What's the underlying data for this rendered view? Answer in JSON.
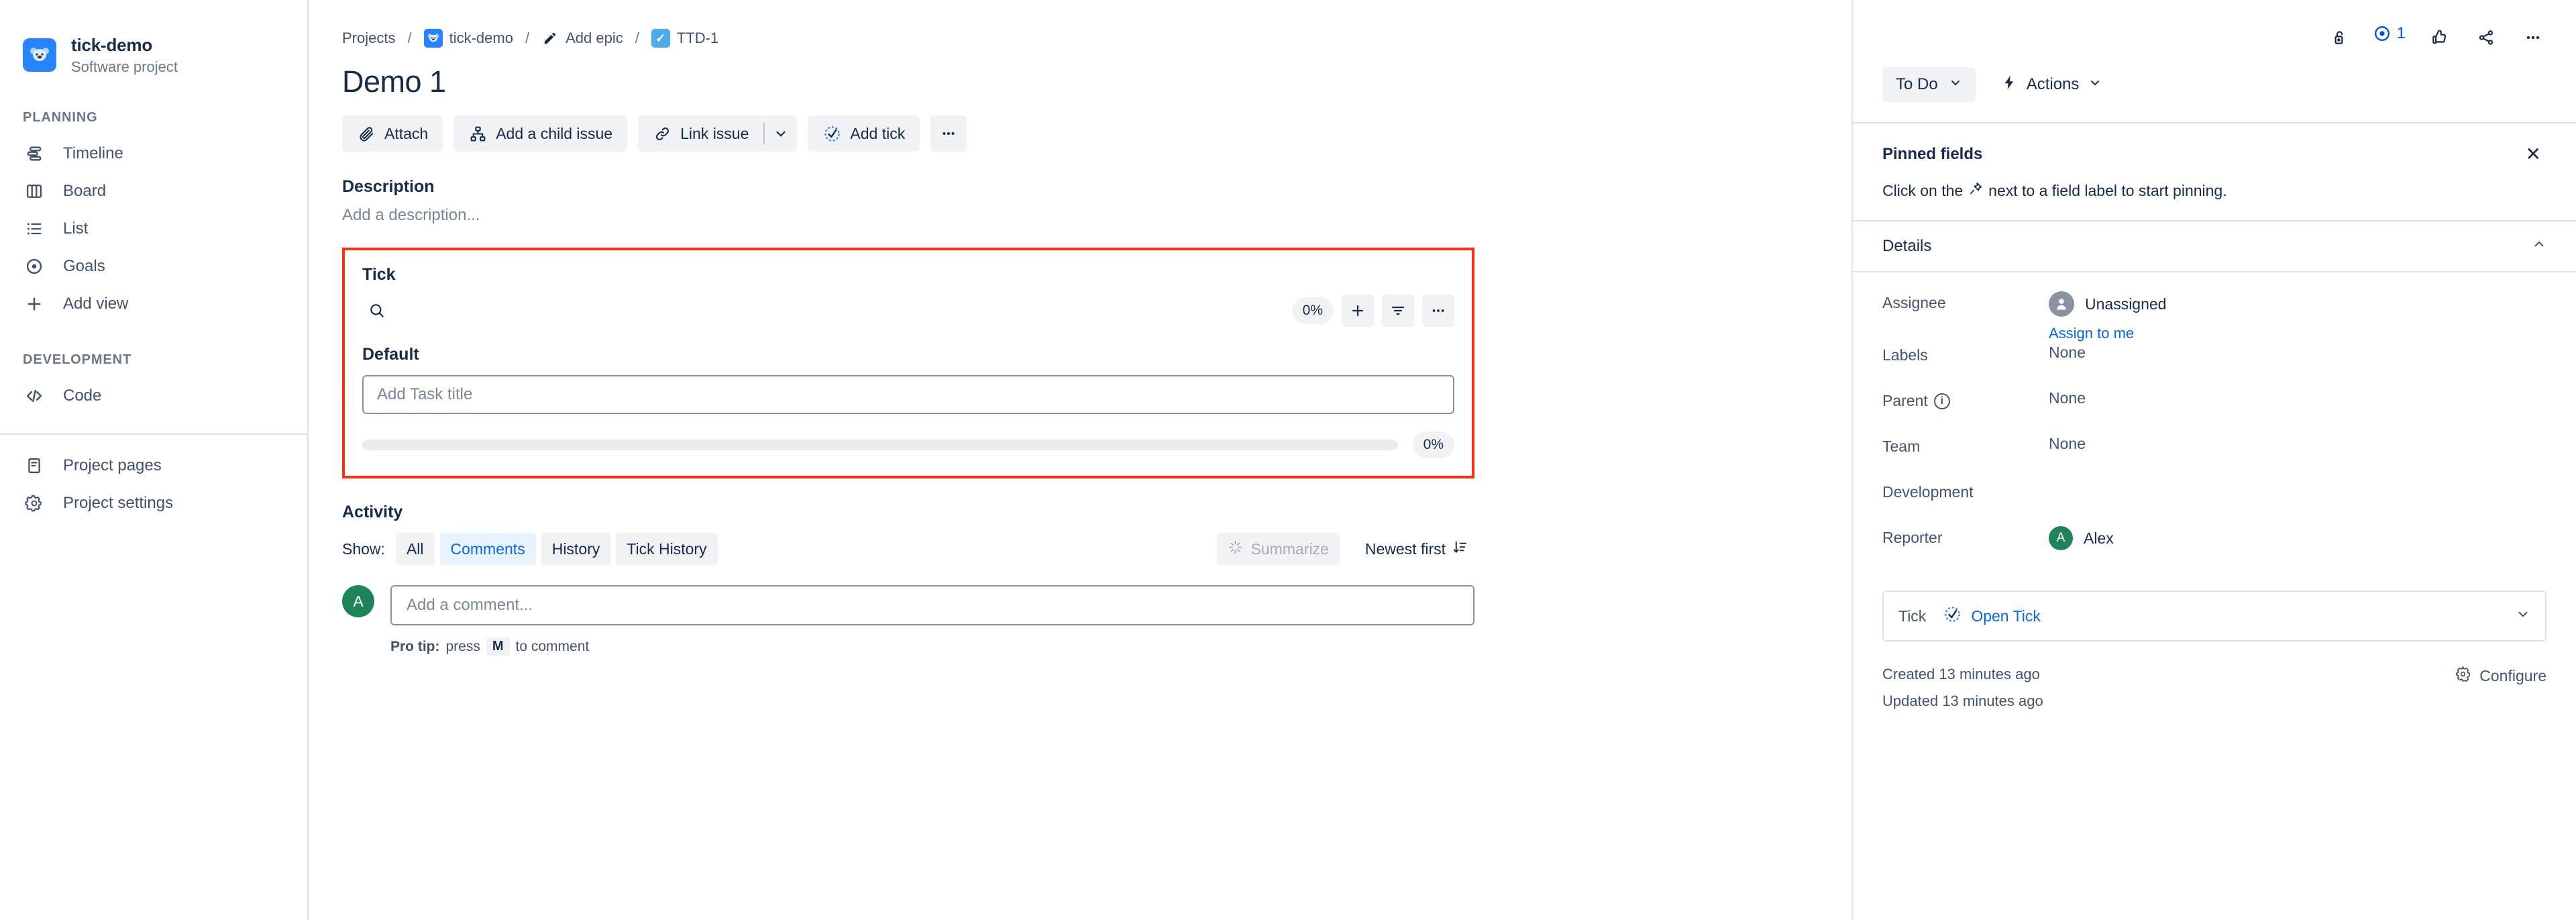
{
  "sidebar": {
    "project": {
      "name": "tick-demo",
      "type": "Software project",
      "avatar_icon": "koala-avatar",
      "avatar_color": "#2684ff"
    },
    "sections": [
      {
        "label": "PLANNING",
        "items": [
          {
            "label": "Timeline",
            "icon": "timeline-icon"
          },
          {
            "label": "Board",
            "icon": "board-icon"
          },
          {
            "label": "List",
            "icon": "list-icon"
          },
          {
            "label": "Goals",
            "icon": "goals-icon"
          },
          {
            "label": "Add view",
            "icon": "plus-icon"
          }
        ]
      },
      {
        "label": "DEVELOPMENT",
        "items": [
          {
            "label": "Code",
            "icon": "code-icon"
          }
        ]
      }
    ],
    "footer_items": [
      {
        "label": "Project pages",
        "icon": "pages-icon"
      },
      {
        "label": "Project settings",
        "icon": "gear-icon"
      }
    ]
  },
  "breadcrumb": {
    "projects": "Projects",
    "project": "tick-demo",
    "epic": "Add epic",
    "issue_key": "TTD-1",
    "separator": "/"
  },
  "issue": {
    "title": "Demo 1",
    "actions": [
      {
        "label": "Attach",
        "icon": "paperclip-icon"
      },
      {
        "label": "Add a child issue",
        "icon": "child-issue-icon"
      },
      {
        "label": "Link issue",
        "icon": "link-icon",
        "has_caret": true
      },
      {
        "label": "Add tick",
        "icon": "tick-clock-icon"
      }
    ],
    "more_label": "•••"
  },
  "description": {
    "heading": "Description",
    "placeholder": "Add a description..."
  },
  "tick_panel": {
    "heading": "Tick",
    "search_icon": "search-icon",
    "percent_pill": "0%",
    "tools": [
      {
        "icon": "plus-icon",
        "name": "add-task-button"
      },
      {
        "icon": "filter-icon",
        "name": "filter-button"
      },
      {
        "icon": "more-icon",
        "name": "more-options-button"
      }
    ],
    "group_title": "Default",
    "task_input_placeholder": "Add Task title",
    "task_input_value": "",
    "progress_percent": 0,
    "progress_label": "0%",
    "highlight_color": "#ff2d16"
  },
  "activity": {
    "heading": "Activity",
    "show_label": "Show:",
    "tabs": [
      {
        "label": "All",
        "active": false
      },
      {
        "label": "Comments",
        "active": true
      },
      {
        "label": "History",
        "active": false
      },
      {
        "label": "Tick History",
        "active": false
      }
    ],
    "summarize_label": "Summarize",
    "sort_label": "Newest first",
    "comment": {
      "avatar_initial": "A",
      "avatar_color": "#1f845a",
      "placeholder": "Add a comment...",
      "value": ""
    },
    "protip": {
      "prefix": "Pro tip:",
      "text_before": "press",
      "key": "M",
      "text_after": "to comment"
    }
  },
  "right_panel": {
    "top_icons": [
      {
        "name": "unlock-icon"
      },
      {
        "name": "watch-eye-icon",
        "count": "1"
      },
      {
        "name": "thumbs-up-icon"
      },
      {
        "name": "share-icon"
      },
      {
        "name": "more-icon"
      }
    ],
    "status": {
      "label": "To Do",
      "caret": "⌄"
    },
    "actions": {
      "label": "Actions",
      "icon": "lightning-icon",
      "caret": "⌄"
    },
    "pinned_fields": {
      "title": "Pinned fields",
      "close": "✕",
      "text_before": "Click on the",
      "icon": "pin-icon",
      "text_after": "next to a field label to start pinning."
    },
    "details": {
      "title": "Details",
      "collapse_caret": "⌃",
      "fields": [
        {
          "label": "Assignee",
          "value": "Unassigned",
          "type": "person-unassigned",
          "link": "Assign to me"
        },
        {
          "label": "Labels",
          "value": "None",
          "type": "text"
        },
        {
          "label": "Parent",
          "value": "None",
          "type": "text",
          "info_icon": true
        },
        {
          "label": "Team",
          "value": "None",
          "type": "text"
        },
        {
          "label": "Development",
          "value": "",
          "type": "text"
        },
        {
          "label": "Reporter",
          "value": "Alex",
          "type": "person",
          "avatar_initial": "A",
          "avatar_color": "#1f845a"
        }
      ]
    },
    "tick_field": {
      "label": "Tick",
      "value": "Open Tick",
      "icon": "tick-clock-icon",
      "caret": "⌄"
    },
    "created": "Created 13 minutes ago",
    "updated": "Updated 13 minutes ago",
    "configure": "Configure"
  }
}
